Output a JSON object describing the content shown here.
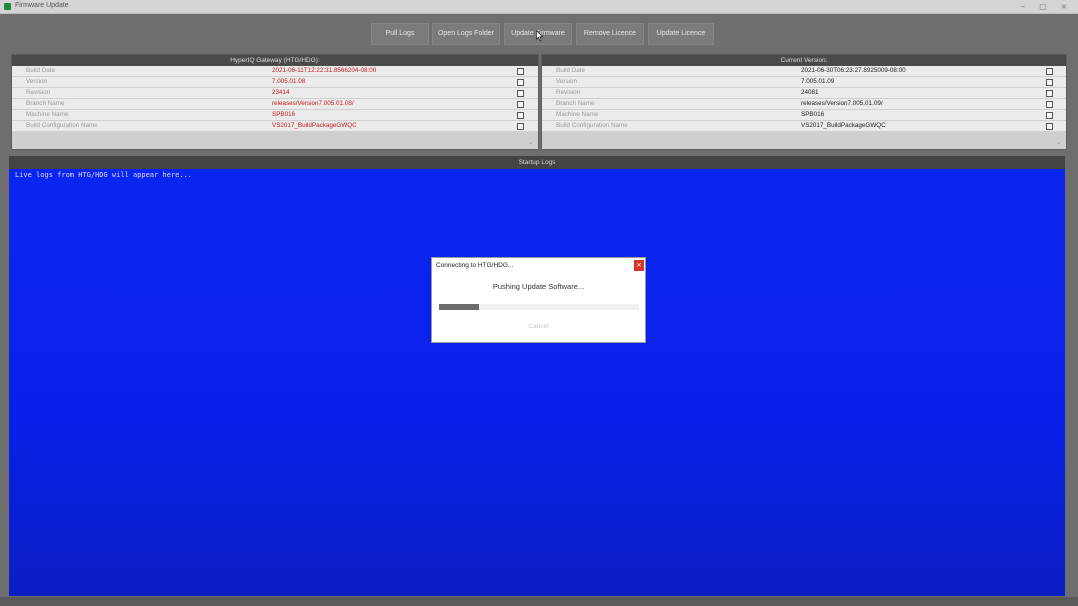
{
  "window": {
    "title": "Firmware Update",
    "minimize": "–",
    "maximize": "□",
    "close": "×"
  },
  "toolbar": {
    "buttons": [
      "Pull Logs",
      "Open Logs Folder",
      "Update Firmware",
      "Remove Licence",
      "Update Licence"
    ]
  },
  "left_panel": {
    "title": "HyperIQ Gateway (HTG/HDG):",
    "rows": [
      {
        "key": "Build Date",
        "value": "2021-06-11T12:22:31.8566204-08:00"
      },
      {
        "key": "Version",
        "value": "7.005.01.08"
      },
      {
        "key": "Revision",
        "value": "23414"
      },
      {
        "key": "Branch Name",
        "value": "releases/Version7.005.01.08/"
      },
      {
        "key": "Machine Name",
        "value": "SPB016"
      },
      {
        "key": "Build Configuration Name",
        "value": "VS2017_BuildPackageGWQC"
      }
    ]
  },
  "right_panel": {
    "title": "Current Version:",
    "rows": [
      {
        "key": "Build Date",
        "value": "2021-06-30T06:23:27.8925009-08:00"
      },
      {
        "key": "Version",
        "value": "7.005.01.09"
      },
      {
        "key": "Revision",
        "value": "24081"
      },
      {
        "key": "Branch Name",
        "value": "releases/Version7.005.01.09/"
      },
      {
        "key": "Machine Name",
        "value": "SPB016"
      },
      {
        "key": "Build Configuration Name",
        "value": "VS2017_BuildPackageGWQC"
      }
    ]
  },
  "logs": {
    "header": "Startup Logs",
    "text": "Live logs from HTG/HDG will appear here..."
  },
  "dialog": {
    "title": "Connecting to HTG/HDG...",
    "message": "Pushing Update Software...",
    "progress": 0.2,
    "cancel_label": "Cancel",
    "close_glyph": "×"
  },
  "colors": {
    "log_background": "#0b25f0",
    "left_value_text": "#c11d1d",
    "dialog_close": "#d9342b"
  }
}
